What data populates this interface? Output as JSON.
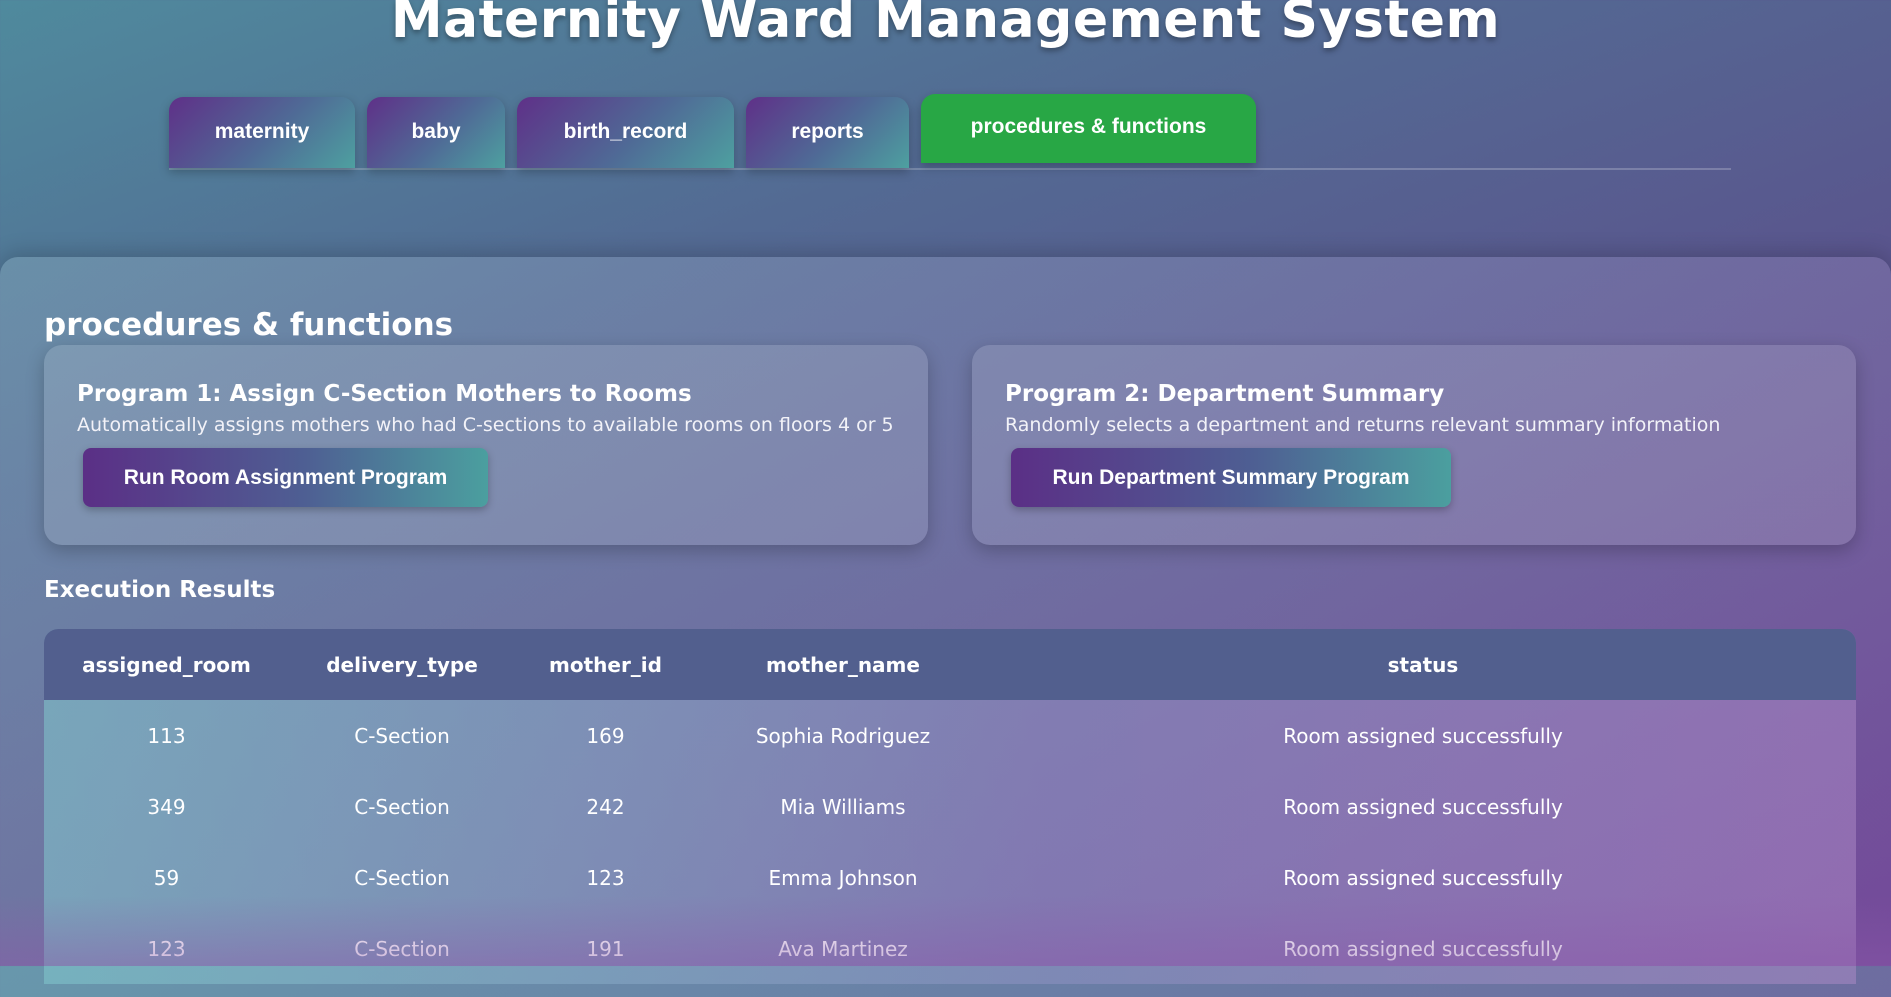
{
  "app": {
    "title": "Maternity Ward Management System"
  },
  "tabs": [
    {
      "label": "maternity",
      "active": false
    },
    {
      "label": "baby",
      "active": false
    },
    {
      "label": "birth_record",
      "active": false
    },
    {
      "label": "reports",
      "active": false
    },
    {
      "label": "procedures & functions",
      "active": true
    }
  ],
  "section": {
    "title": "procedures & functions"
  },
  "programs": [
    {
      "title": "Program 1: Assign C-Section Mothers to Rooms",
      "description": "Automatically assigns mothers who had C-sections to available rooms on floors 4 or 5",
      "button_label": "Run Room Assignment Program"
    },
    {
      "title": "Program 2: Department Summary",
      "description": "Randomly selects a department and returns relevant summary information",
      "button_label": "Run Department Summary Program"
    }
  ],
  "results": {
    "title": "Execution Results",
    "columns": [
      "assigned_room",
      "delivery_type",
      "mother_id",
      "mother_name",
      "status"
    ],
    "rows": [
      [
        "113",
        "C-Section",
        "169",
        "Sophia Rodriguez",
        "Room assigned successfully"
      ],
      [
        "349",
        "C-Section",
        "242",
        "Mia Williams",
        "Room assigned successfully"
      ],
      [
        "59",
        "C-Section",
        "123",
        "Emma Johnson",
        "Room assigned successfully"
      ],
      [
        "123",
        "C-Section",
        "191",
        "Ava Martinez",
        "Room assigned successfully"
      ]
    ]
  },
  "colors": {
    "active_tab": "#28a745",
    "table_header": "#525f8e",
    "accent_purple": "#5b2f86",
    "accent_teal": "#4b9f9f"
  }
}
